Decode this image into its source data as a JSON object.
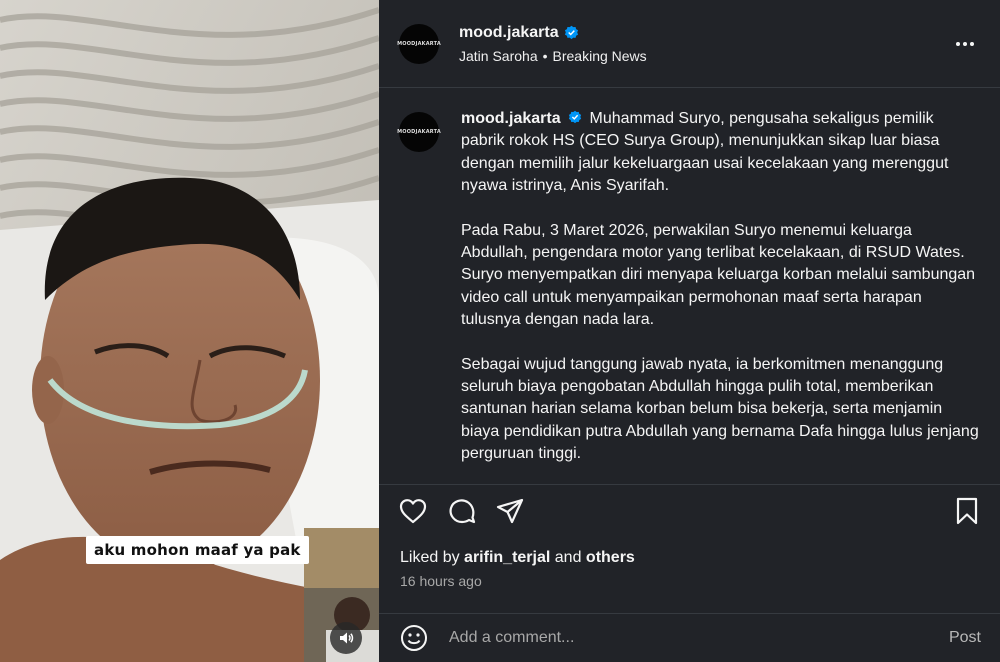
{
  "media": {
    "caption": "aku mohon maaf ya pak",
    "mute_icon": "speaker-icon"
  },
  "account": {
    "username": "mood.jakarta",
    "avatar_text": "MOODJAKARTA",
    "verified": true,
    "location": "Jatin Saroha",
    "separator": "•",
    "audio": "Breaking News"
  },
  "post": {
    "username": "mood.jakarta",
    "paragraphs": [
      "Muhammad Suryo, pengusaha sekaligus pemilik pabrik rokok HS (CEO Surya Group), menunjukkan sikap luar biasa dengan memilih jalur kekeluargaan usai kecelakaan yang merenggut nyawa istrinya, Anis Syarifah.",
      "Pada Rabu, 3 Maret 2026, perwakilan Suryo menemui keluarga Abdullah, pengendara motor yang terlibat kecelakaan, di RSUD Wates. Suryo menyempatkan diri menyapa keluarga korban melalui sambungan video call untuk menyampaikan permohonan maaf serta harapan tulusnya dengan nada lara.",
      "Sebagai wujud tanggung jawab nyata, ia berkomitmen menanggung seluruh biaya pengobatan Abdullah hingga pulih total, memberikan santunan harian selama korban belum bisa bekerja, serta menjamin biaya pendidikan putra Abdullah yang bernama Dafa hingga lulus jenjang perguruan tinggi."
    ]
  },
  "actions": {
    "like_icon": "heart-icon",
    "comment_icon": "comment-icon",
    "share_icon": "share-icon",
    "save_icon": "bookmark-icon"
  },
  "likes": {
    "prefix": "Liked by",
    "user": "arifin_terjal",
    "conj": "and",
    "others": "others"
  },
  "timestamp": "16 hours ago",
  "comment": {
    "placeholder": "Add a comment...",
    "post_label": "Post",
    "emoji_icon": "emoji-icon"
  },
  "colors": {
    "panel_bg": "#212328",
    "verified_blue": "#0095f6",
    "muted_text": "#a8a8a8"
  }
}
